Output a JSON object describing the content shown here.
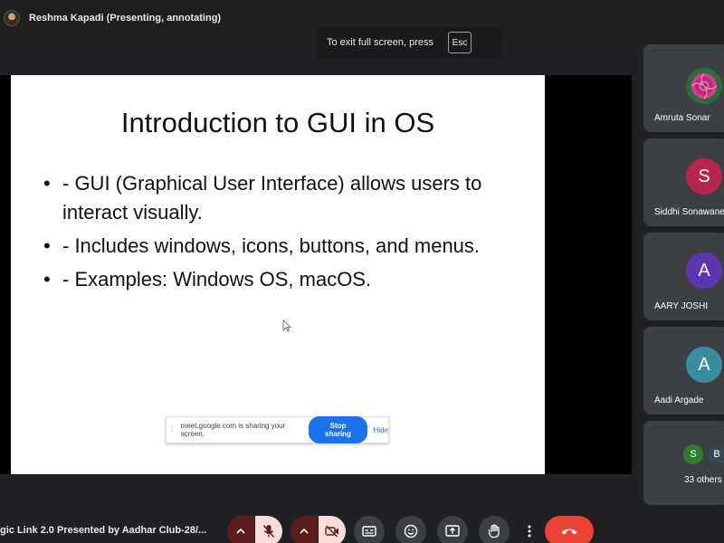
{
  "topbar": {
    "presenter_label": "Reshma Kapadi (Presenting, annotating)",
    "exit_fullscreen_text": "To exit full screen, press",
    "esc_key": "Esc"
  },
  "slide": {
    "title": "Introduction to GUI in OS",
    "bullets": [
      "- GUI (Graphical User Interface) allows users to interact visually.",
      "- Includes windows, icons, buttons, and menus.",
      "- Examples: Windows OS, macOS."
    ]
  },
  "share_banner": {
    "text": "meet.google.com is sharing your screen.",
    "stop_label": "Stop sharing",
    "hide_label": "Hide"
  },
  "participants": [
    {
      "name": "Amruta Sonar",
      "initial": "",
      "avatar_color": "#2d6a3e"
    },
    {
      "name": "Siddhi Sonawane",
      "initial": "S",
      "avatar_color": "#b7264f"
    },
    {
      "name": "AARY JOSHI",
      "initial": "A",
      "avatar_color": "#5e35b1"
    },
    {
      "name": "Aadi Argade",
      "initial": "A",
      "avatar_color": "#3a8ca0"
    }
  ],
  "others": {
    "label": "33 others",
    "avatars": [
      {
        "initial": "S",
        "color": "#2e7d32"
      },
      {
        "initial": "B",
        "color": "#37474f"
      }
    ]
  },
  "bottombar": {
    "meeting_title": "gic Link 2.0 Presented by Aadhar Club-28/...",
    "controls": [
      "chevron-up",
      "mic-off",
      "chevron-up",
      "camera-off",
      "captions",
      "emoji",
      "present",
      "raise-hand",
      "more",
      "end-call"
    ]
  },
  "colors": {
    "end_call": "#ea4335",
    "primary_blue": "#1a73e8",
    "control_bg": "#3c4043",
    "muted_bg": "#f9dedc"
  }
}
